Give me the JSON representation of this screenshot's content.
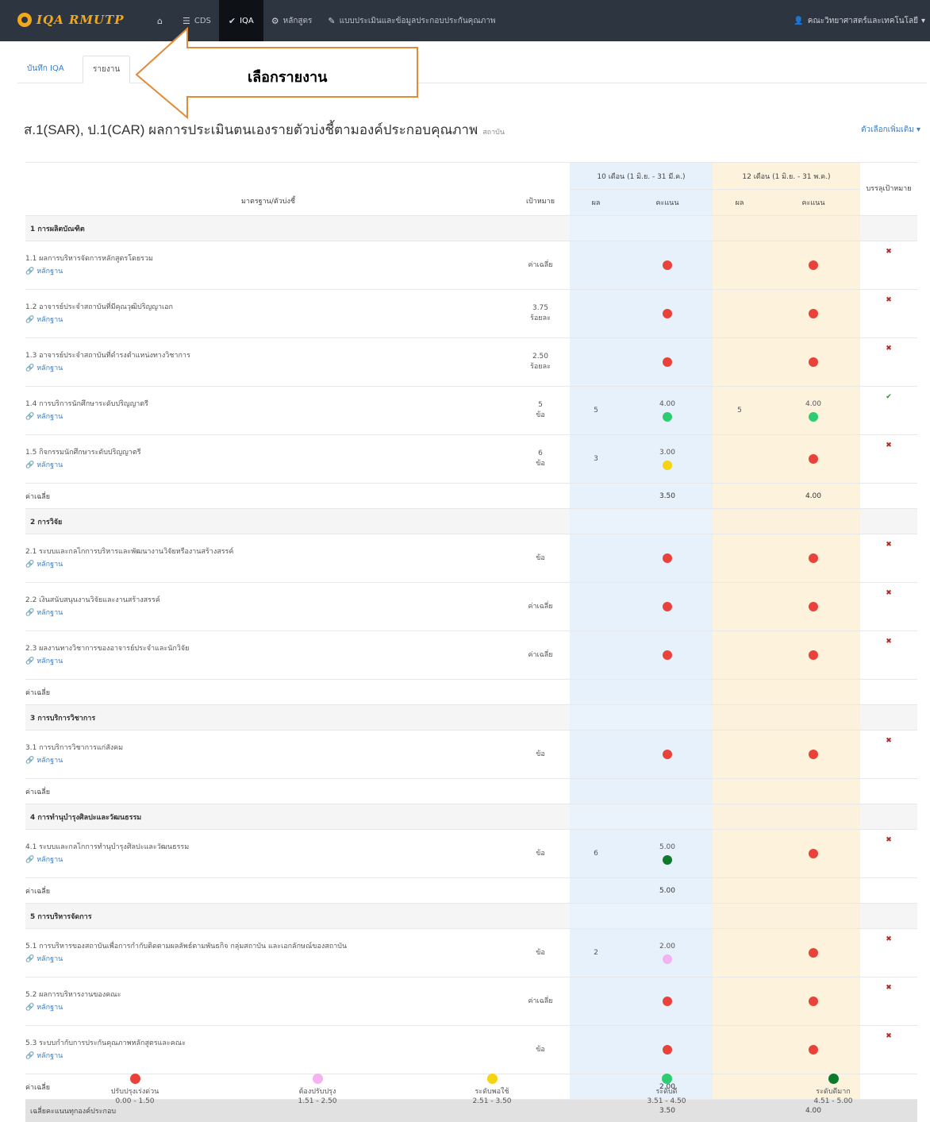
{
  "colors": {
    "red": "#e8423b",
    "green": "#2ecc71",
    "darkgreen": "#0f7a2e",
    "yellow": "#f5d311",
    "pink": "#f3b3f0"
  },
  "nav": {
    "brand": "IQA RMUTP",
    "items": [
      {
        "icon": "home-icon",
        "label": ""
      },
      {
        "icon": "list-icon",
        "label": "CDS"
      },
      {
        "icon": "check-circle-icon",
        "label": "IQA",
        "active": true
      },
      {
        "icon": "gear-icon",
        "label": "หลักสูตร"
      },
      {
        "icon": "edit-icon",
        "label": "แบบประเมินและข้อมูลประกอบประกันคุณภาพ"
      }
    ],
    "user": "คณะวิทยาศาสตร์และเทคโนโลยี"
  },
  "subtabs": [
    "บันทึก IQA",
    "รายงาน"
  ],
  "annotation": "เลือกรายงาน",
  "title": {
    "main": "ส.1(SAR), ป.1(CAR) ผลการประเมินตนเองรายตัวบ่งชี้ตามองค์ประกอบคุณภาพ",
    "sub": "สถาบัน",
    "options": "ตัวเลือกเพิ่มเติม ▾"
  },
  "headers": {
    "period10": "10 เดือน (1 มิ.ย. - 31 มี.ค.)",
    "period12": "12 เดือน (1 มิ.ย. - 31 พ.ค.)",
    "standard": "มาตรฐาน/ตัวบ่งชี้",
    "target": "เป้าหมาย",
    "result": "ผล",
    "score": "คะแนน",
    "achieve": "บรรลุเป้าหมาย"
  },
  "evidence_label": "หลักฐาน",
  "avg_label": "ค่าเฉลี่ย",
  "groups": [
    {
      "title": "1 การผลิตบัณฑิต",
      "items": [
        {
          "name": "1.1 ผลการบริหารจัดการหลักสูตรโดยรวม",
          "target": "ค่าเฉลี่ย",
          "target2": "",
          "r10": "",
          "s10": "",
          "c10": "red",
          "r12": "",
          "s12": "",
          "c12": "red",
          "ok": false
        },
        {
          "name": "1.2 อาจารย์ประจำสถาบันที่มีคุณวุฒิปริญญาเอก",
          "target": "3.75",
          "target2": "ร้อยละ",
          "r10": "",
          "s10": "",
          "c10": "red",
          "r12": "",
          "s12": "",
          "c12": "red",
          "ok": false
        },
        {
          "name": "1.3 อาจารย์ประจำสถาบันที่ดำรงตำแหน่งทางวิชาการ",
          "target": "2.50",
          "target2": "ร้อยละ",
          "r10": "",
          "s10": "",
          "c10": "red",
          "r12": "",
          "s12": "",
          "c12": "red",
          "ok": false
        },
        {
          "name": "1.4 การบริการนักศึกษาระดับปริญญาตรี",
          "target": "5",
          "target2": "ข้อ",
          "r10": "5",
          "s10": "4.00",
          "c10": "green",
          "r12": "5",
          "s12": "4.00",
          "c12": "green",
          "ok": true
        },
        {
          "name": "1.5 กิจกรรมนักศึกษาระดับปริญญาตรี",
          "target": "6",
          "target2": "ข้อ",
          "r10": "3",
          "s10": "3.00",
          "c10": "yellow",
          "r12": "",
          "s12": "",
          "c12": "red",
          "ok": false
        }
      ],
      "avg10": "3.50",
      "avg12": "4.00"
    },
    {
      "title": "2 การวิจัย",
      "items": [
        {
          "name": "2.1 ระบบและกลไกการบริหารและพัฒนางานวิจัยหรืองานสร้างสรรค์",
          "target": "ข้อ",
          "target2": "",
          "r10": "",
          "s10": "",
          "c10": "red",
          "r12": "",
          "s12": "",
          "c12": "red",
          "ok": false
        },
        {
          "name": "2.2 เงินสนับสนุนงานวิจัยและงานสร้างสรรค์",
          "target": "ค่าเฉลี่ย",
          "target2": "",
          "r10": "",
          "s10": "",
          "c10": "red",
          "r12": "",
          "s12": "",
          "c12": "red",
          "ok": false
        },
        {
          "name": "2.3 ผลงานทางวิชาการของอาจารย์ประจำและนักวิจัย",
          "target": "ค่าเฉลี่ย",
          "target2": "",
          "r10": "",
          "s10": "",
          "c10": "red",
          "r12": "",
          "s12": "",
          "c12": "red",
          "ok": false
        }
      ],
      "avg10": "",
      "avg12": ""
    },
    {
      "title": "3 การบริการวิชาการ",
      "items": [
        {
          "name": "3.1 การบริการวิชาการแก่สังคม",
          "target": "ข้อ",
          "target2": "",
          "r10": "",
          "s10": "",
          "c10": "red",
          "r12": "",
          "s12": "",
          "c12": "red",
          "ok": false
        }
      ],
      "avg10": "",
      "avg12": ""
    },
    {
      "title": "4 การทำนุบำรุงศิลปะและวัฒนธรรม",
      "items": [
        {
          "name": "4.1 ระบบและกลไกการทำนุบำรุงศิลปะและวัฒนธรรม",
          "target": "ข้อ",
          "target2": "",
          "r10": "6",
          "s10": "5.00",
          "c10": "darkgreen",
          "r12": "",
          "s12": "",
          "c12": "red",
          "ok": false
        }
      ],
      "avg10": "5.00",
      "avg12": ""
    },
    {
      "title": "5 การบริหารจัดการ",
      "items": [
        {
          "name": "5.1 การบริหารของสถาบันเพื่อการกำกับติดตามผลลัพธ์ตามพันธกิจ กลุ่มสถาบัน และเอกลักษณ์ของสถาบัน",
          "target": "ข้อ",
          "target2": "",
          "r10": "2",
          "s10": "2.00",
          "c10": "pink",
          "r12": "",
          "s12": "",
          "c12": "red",
          "ok": false
        },
        {
          "name": "5.2 ผลการบริหารงานของคณะ",
          "target": "ค่าเฉลี่ย",
          "target2": "",
          "r10": "",
          "s10": "",
          "c10": "red",
          "r12": "",
          "s12": "",
          "c12": "red",
          "ok": false
        },
        {
          "name": "5.3 ระบบกำกับการประกันคุณภาพหลักสูตรและคณะ",
          "target": "ข้อ",
          "target2": "",
          "r10": "",
          "s10": "",
          "c10": "red",
          "r12": "",
          "s12": "",
          "c12": "red",
          "ok": false
        }
      ],
      "avg10": "2.00",
      "avg12": ""
    }
  ],
  "total": {
    "label": "เฉลี่ยคะแนนทุกองค์ประกอบ",
    "v10": "3.50",
    "v12": "4.00"
  },
  "legend": [
    {
      "color": "red",
      "label": "ปรับปรุงเร่งด่วน",
      "range": "0.00 - 1.50"
    },
    {
      "color": "pink",
      "label": "ต้องปรับปรุง",
      "range": "1.51 - 2.50"
    },
    {
      "color": "yellow",
      "label": "ระดับพอใช้",
      "range": "2.51 - 3.50"
    },
    {
      "color": "green",
      "label": "ระดับดี",
      "range": "3.51 - 4.50"
    },
    {
      "color": "darkgreen",
      "label": "ระดับดีมาก",
      "range": "4.51 - 5.00"
    }
  ]
}
